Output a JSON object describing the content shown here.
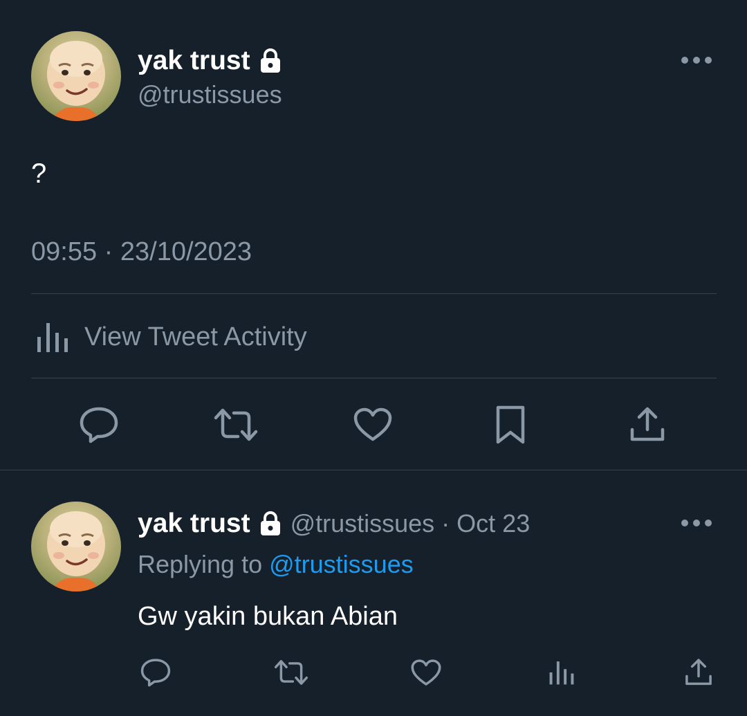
{
  "main_tweet": {
    "display_name": "yak trust",
    "handle": "@trustissues",
    "text": "?",
    "timestamp": "09:55 · 23/10/2023",
    "activity_label": "View Tweet Activity",
    "avatar_icon": "cartoon-avatar",
    "protected_icon": "lock-icon",
    "actions": [
      "reply-icon",
      "retweet-icon",
      "like-icon",
      "bookmark-icon",
      "share-icon"
    ]
  },
  "reply": {
    "display_name": "yak trust",
    "handle_meta": "@trustissues · Oct 23",
    "replying_to_prefix": "Replying to ",
    "replying_to_handle": "@trustissues",
    "text": "Gw yakin bukan Abian",
    "actions": [
      "reply-icon",
      "retweet-icon",
      "like-icon",
      "views-icon",
      "share-icon"
    ]
  },
  "colors": {
    "background": "#15202b",
    "text_primary": "#ffffff",
    "text_secondary": "#8b98a5",
    "link": "#1d9bf0",
    "divider": "#38444d"
  }
}
